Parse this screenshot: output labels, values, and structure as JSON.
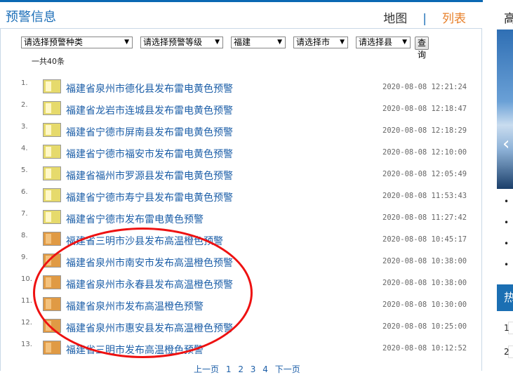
{
  "header": {
    "title": "预警信息",
    "tab_map": "地图",
    "tab_sep": "|",
    "tab_list": "列表"
  },
  "filters": {
    "type": "请选择预警种类",
    "level": "请选择预警等级",
    "province": "福建",
    "city": "请选择市",
    "county": "请选择县",
    "query_label": "查询",
    "arrow": "▼"
  },
  "count_text": "一共40条",
  "warnings": [
    {
      "num": "1.",
      "title": "福建省泉州市德化县发布雷电黄色预警",
      "time": "2020-08-08 12:21:24",
      "level": "yellow",
      "icon": "thunder-yellow-icon"
    },
    {
      "num": "2.",
      "title": "福建省龙岩市连城县发布雷电黄色预警",
      "time": "2020-08-08 12:18:47",
      "level": "yellow",
      "icon": "thunder-yellow-icon"
    },
    {
      "num": "3.",
      "title": "福建省宁德市屏南县发布雷电黄色预警",
      "time": "2020-08-08 12:18:29",
      "level": "yellow",
      "icon": "thunder-yellow-icon"
    },
    {
      "num": "4.",
      "title": "福建省宁德市福安市发布雷电黄色预警",
      "time": "2020-08-08 12:10:00",
      "level": "yellow",
      "icon": "thunder-yellow-icon"
    },
    {
      "num": "5.",
      "title": "福建省福州市罗源县发布雷电黄色预警",
      "time": "2020-08-08 12:05:49",
      "level": "yellow",
      "icon": "thunder-yellow-icon"
    },
    {
      "num": "6.",
      "title": "福建省宁德市寿宁县发布雷电黄色预警",
      "time": "2020-08-08 11:53:43",
      "level": "yellow",
      "icon": "thunder-yellow-icon"
    },
    {
      "num": "7.",
      "title": "福建省宁德市发布雷电黄色预警",
      "time": "2020-08-08 11:27:42",
      "level": "yellow",
      "icon": "thunder-yellow-icon"
    },
    {
      "num": "8.",
      "title": "福建省三明市沙县发布高温橙色预警",
      "time": "2020-08-08 10:45:17",
      "level": "orange",
      "icon": "heat-orange-icon"
    },
    {
      "num": "9.",
      "title": "福建省泉州市南安市发布高温橙色预警",
      "time": "2020-08-08 10:38:00",
      "level": "orange",
      "icon": "heat-orange-icon"
    },
    {
      "num": "10.",
      "title": "福建省泉州市永春县发布高温橙色预警",
      "time": "2020-08-08 10:38:00",
      "level": "orange",
      "icon": "heat-orange-icon"
    },
    {
      "num": "11.",
      "title": "福建省泉州市发布高温橙色预警",
      "time": "2020-08-08 10:30:00",
      "level": "orange",
      "icon": "heat-orange-icon"
    },
    {
      "num": "12.",
      "title": "福建省泉州市惠安县发布高温橙色预警",
      "time": "2020-08-08 10:25:00",
      "level": "orange",
      "icon": "heat-orange-icon"
    },
    {
      "num": "13.",
      "title": "福建省三明市发布高温橙色预警",
      "time": "2020-08-08 10:12:52",
      "level": "orange",
      "icon": "heat-orange-icon"
    }
  ],
  "pager": {
    "prev": "上一页",
    "pages": [
      "1",
      "2",
      "3",
      "4"
    ],
    "next": "下一页"
  },
  "sidebar": {
    "title": "高",
    "hot_label": "热",
    "bullet": "•",
    "nums": [
      "1",
      "2"
    ],
    "chevron": "‹"
  },
  "colors": {
    "accent": "#1d6fb8",
    "active_tab": "#e8802a",
    "highlight": "#ee1111",
    "yellow": "#e6da6c",
    "orange": "#e09a44"
  }
}
